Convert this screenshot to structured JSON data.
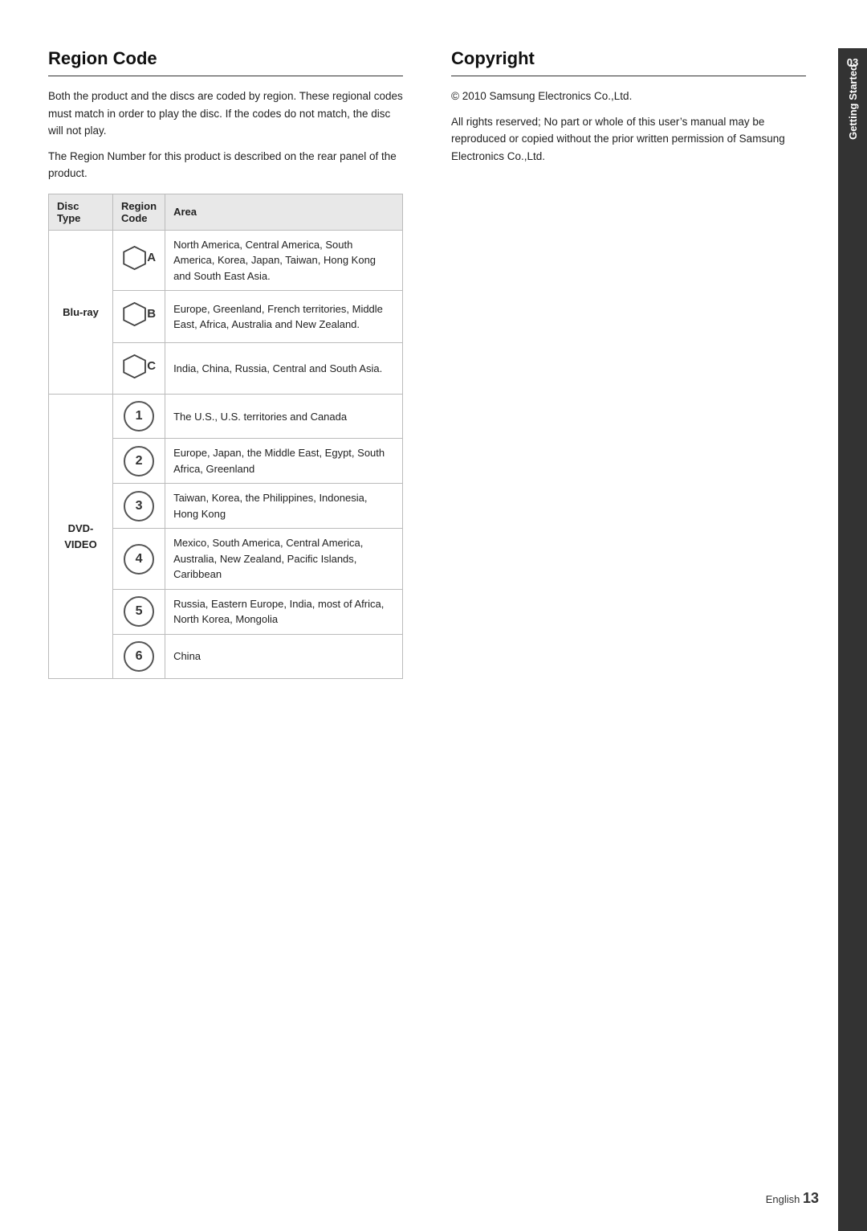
{
  "left_section": {
    "title": "Region Code",
    "paragraphs": [
      "Both the product and the discs are coded by region. These regional codes must match in order to play the disc. If the codes do not match, the disc will not play.",
      "The Region Number for this product is described on the rear panel of the product."
    ],
    "table": {
      "headers": [
        "Disc Type",
        "Region Code",
        "Area"
      ],
      "rows": [
        {
          "disc_type": "",
          "disc_type_label": "",
          "region_icon": "A",
          "icon_type": "hex",
          "area": "North America, Central America, South America, Korea, Japan, Taiwan, Hong Kong and South East Asia."
        },
        {
          "disc_type": "Blu-ray",
          "disc_type_label": "Blu-ray",
          "region_icon": "B",
          "icon_type": "hex",
          "area": "Europe, Greenland, French territories, Middle East, Africa, Australia and New Zealand."
        },
        {
          "disc_type": "",
          "disc_type_label": "",
          "region_icon": "C",
          "icon_type": "hex",
          "area": "India, China, Russia, Central and South Asia."
        },
        {
          "disc_type": "",
          "disc_type_label": "",
          "region_icon": "1",
          "icon_type": "circle",
          "area": "The U.S., U.S. territories and Canada"
        },
        {
          "disc_type": "",
          "disc_type_label": "",
          "region_icon": "2",
          "icon_type": "circle",
          "area": "Europe, Japan, the Middle East, Egypt, South Africa, Greenland"
        },
        {
          "disc_type": "",
          "disc_type_label": "",
          "region_icon": "3",
          "icon_type": "circle",
          "area": "Taiwan, Korea, the Philippines, Indonesia, Hong Kong"
        },
        {
          "disc_type": "DVD-VIDEO",
          "disc_type_label": "DVD-VIDEO",
          "region_icon": "4",
          "icon_type": "circle",
          "area": "Mexico, South America, Central America, Australia, New Zealand, Pacific Islands, Caribbean"
        },
        {
          "disc_type": "",
          "disc_type_label": "",
          "region_icon": "5",
          "icon_type": "circle",
          "area": "Russia, Eastern Europe, India, most of Africa, North Korea, Mongolia"
        },
        {
          "disc_type": "",
          "disc_type_label": "",
          "region_icon": "6",
          "icon_type": "circle",
          "area": "China"
        }
      ]
    }
  },
  "right_section": {
    "title": "Copyright",
    "copyright_line": "© 2010 Samsung Electronics Co.,Ltd.",
    "rights_text": "All rights reserved; No part or whole of this user’s manual may be reproduced or copied without the prior written permission of Samsung Electronics Co.,Ltd."
  },
  "sidebar": {
    "number": "03",
    "label": "Getting Started"
  },
  "footer": {
    "language": "English",
    "page_number": "13"
  }
}
